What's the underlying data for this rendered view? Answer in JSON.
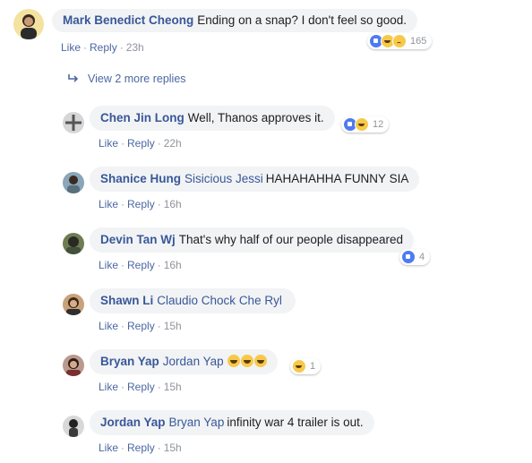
{
  "top_comment": {
    "author": "Mark Benedict Cheong",
    "text": "Ending on a snap? I don't feel so good.",
    "like": "Like",
    "reply": "Reply",
    "time": "23h",
    "reaction_icons": [
      "like-icon",
      "haha-icon",
      "sad-icon"
    ],
    "reaction_count": "165"
  },
  "view_more": {
    "icon": "reply-arrow-icon",
    "label": "View 2 more replies"
  },
  "replies": [
    {
      "author": "Chen Jin Long",
      "tag": "",
      "text": "Well, Thanos approves it.",
      "like": "Like",
      "reply": "Reply",
      "time": "22h",
      "reaction_icons": [
        "like-icon",
        "haha-icon"
      ],
      "reaction_count": "12"
    },
    {
      "author": "Shanice Hung",
      "tag": "Sisicious Jessi",
      "text": "HAHAHAHHA FUNNY SIA",
      "like": "Like",
      "reply": "Reply",
      "time": "16h"
    },
    {
      "author": "Devin Tan Wj",
      "tag": "",
      "text": "That's why half of our people disappeared",
      "like": "Like",
      "reply": "Reply",
      "time": "16h",
      "reaction_icons": [
        "like-icon"
      ],
      "reaction_count": "4"
    },
    {
      "author": "Shawn Li",
      "tag": "Claudio Chock Che Ryl",
      "text": "",
      "like": "Like",
      "reply": "Reply",
      "time": "15h"
    },
    {
      "author": "Bryan Yap",
      "tag": "Jordan Yap",
      "text": "",
      "emojis": [
        "laughing-emoji",
        "laughing-emoji",
        "laughing-emoji"
      ],
      "like": "Like",
      "reply": "Reply",
      "time": "15h",
      "reaction_icons": [
        "haha-icon"
      ],
      "reaction_count": "1"
    },
    {
      "author": "Jordan Yap",
      "tag": "Bryan Yap",
      "text": "infinity war 4 trailer is out.",
      "like": "Like",
      "reply": "Reply",
      "time": "15h"
    }
  ]
}
